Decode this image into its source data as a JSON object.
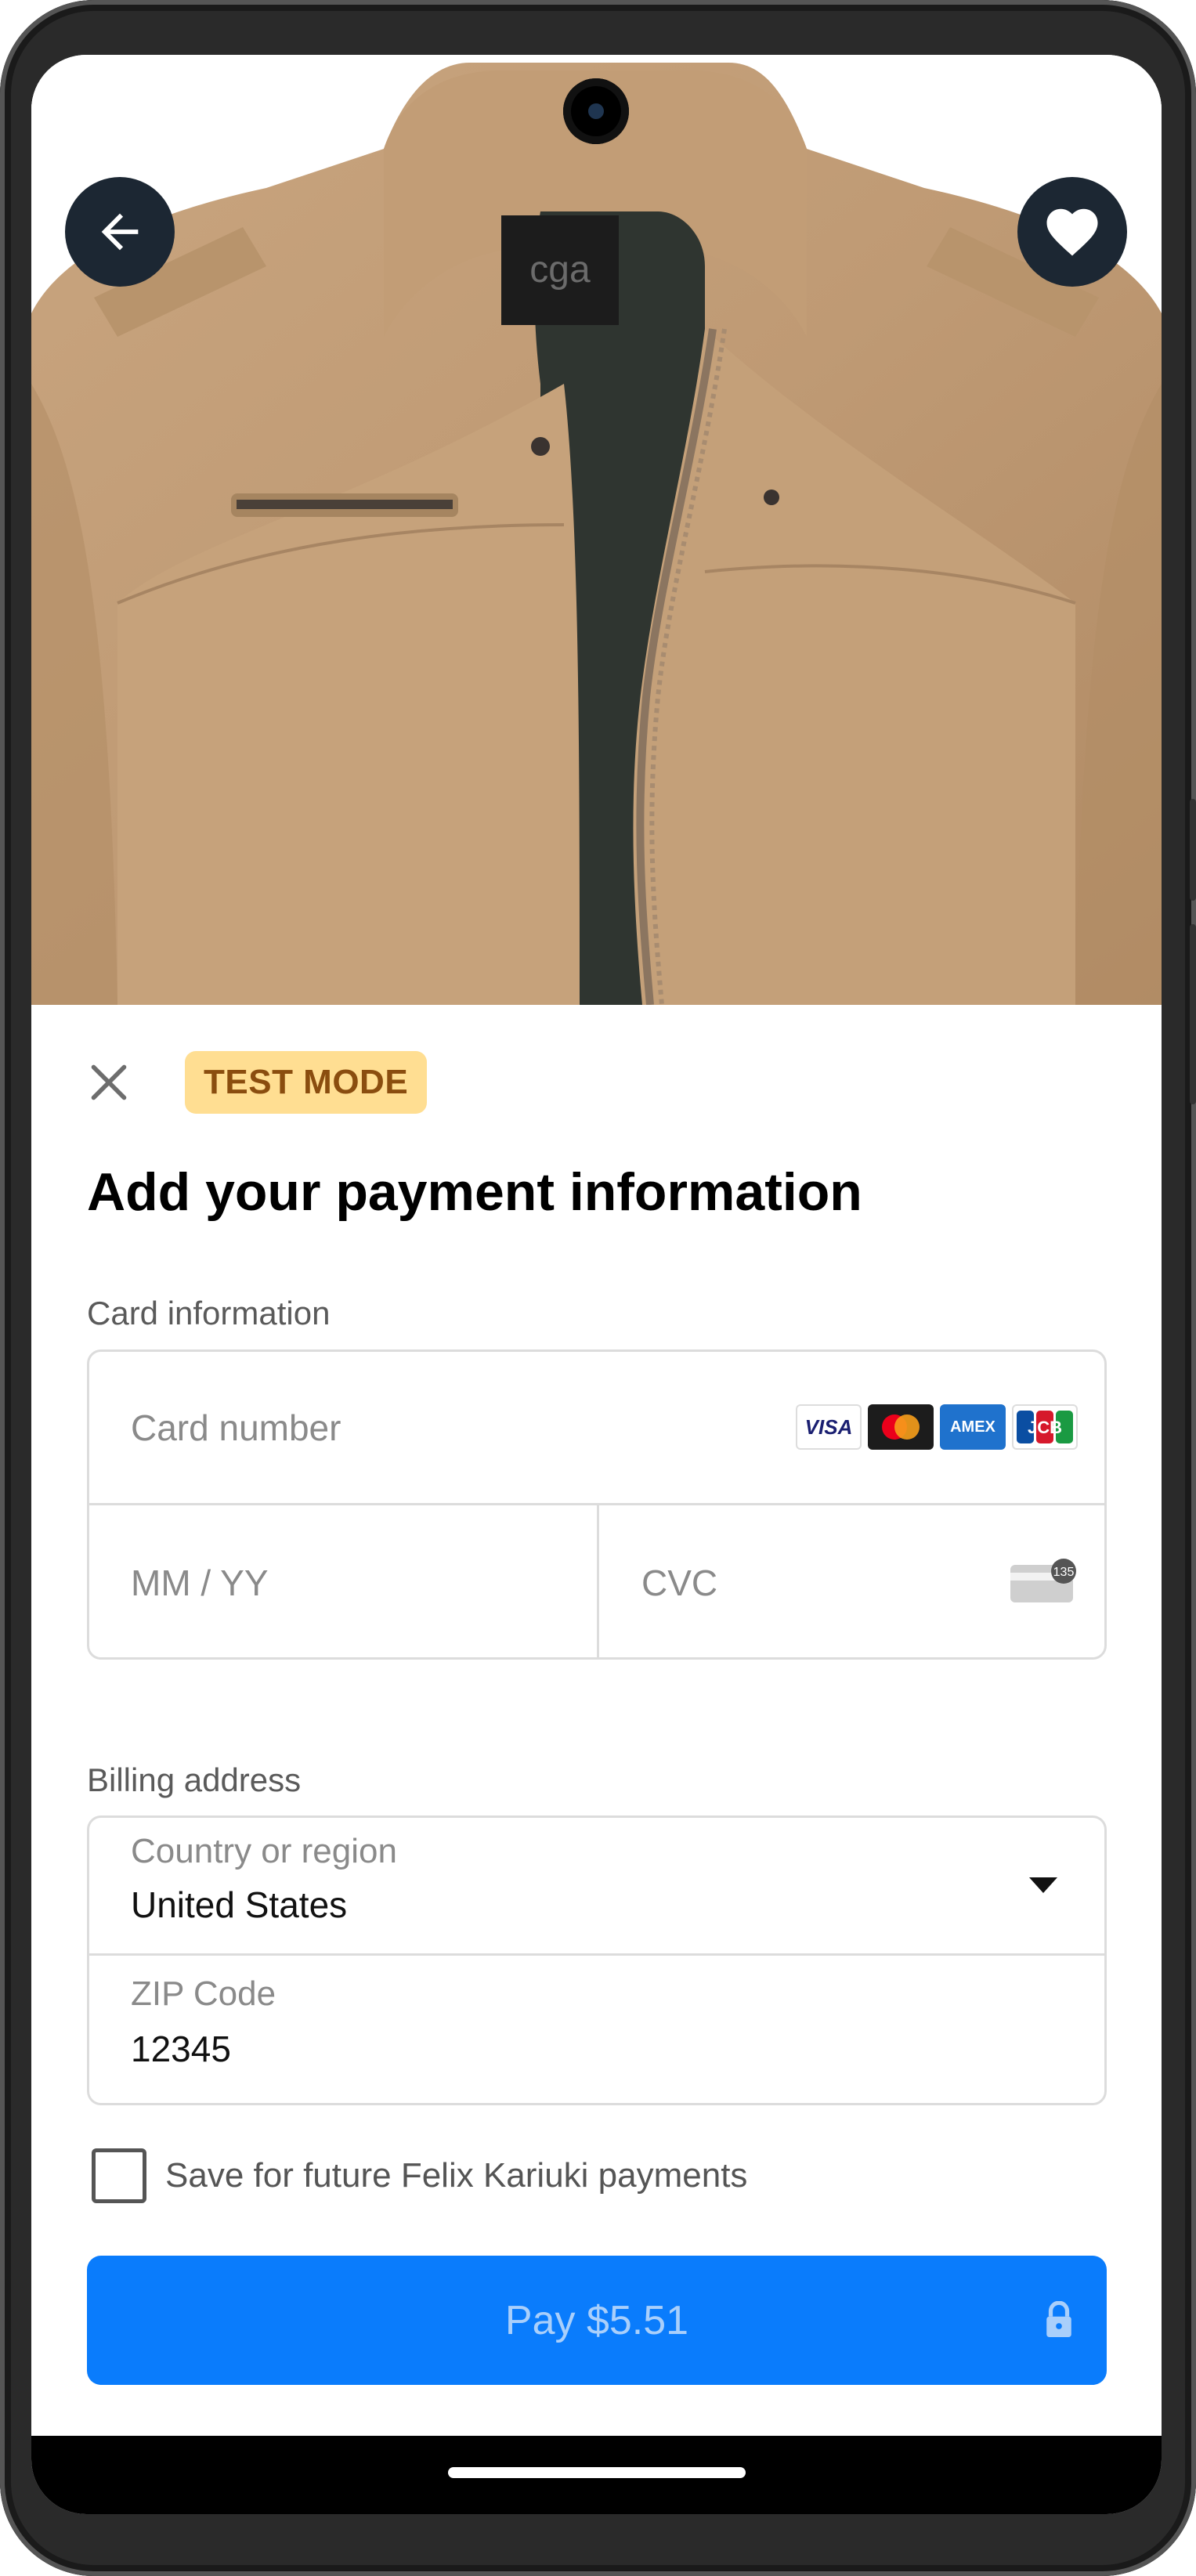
{
  "product": {
    "image_alt": "khaki jacket",
    "back_icon": "arrow-left-icon",
    "favorite_icon": "heart-icon"
  },
  "sheet": {
    "close_icon": "close-icon",
    "test_mode_badge": "TEST MODE",
    "title": "Add your payment information",
    "card_section_label": "Card information",
    "card_number_placeholder": "Card number",
    "card_brands": [
      "VISA",
      "Mastercard",
      "AMEX",
      "JCB"
    ],
    "expiry_placeholder": "MM / YY",
    "cvc_placeholder": "CVC",
    "cvc_icon_text": "135",
    "billing_section_label": "Billing address",
    "country_label": "Country or region",
    "country_value": "United States",
    "zip_label": "ZIP Code",
    "zip_value": "12345",
    "save_label": "Save for future Felix Kariuki payments",
    "save_checked": false,
    "pay_label": "Pay $5.51"
  },
  "colors": {
    "accent": "#0a7cfc",
    "badge_bg": "#ffde92",
    "badge_text": "#8a4d0f",
    "nav_button_bg": "#1c2733"
  }
}
